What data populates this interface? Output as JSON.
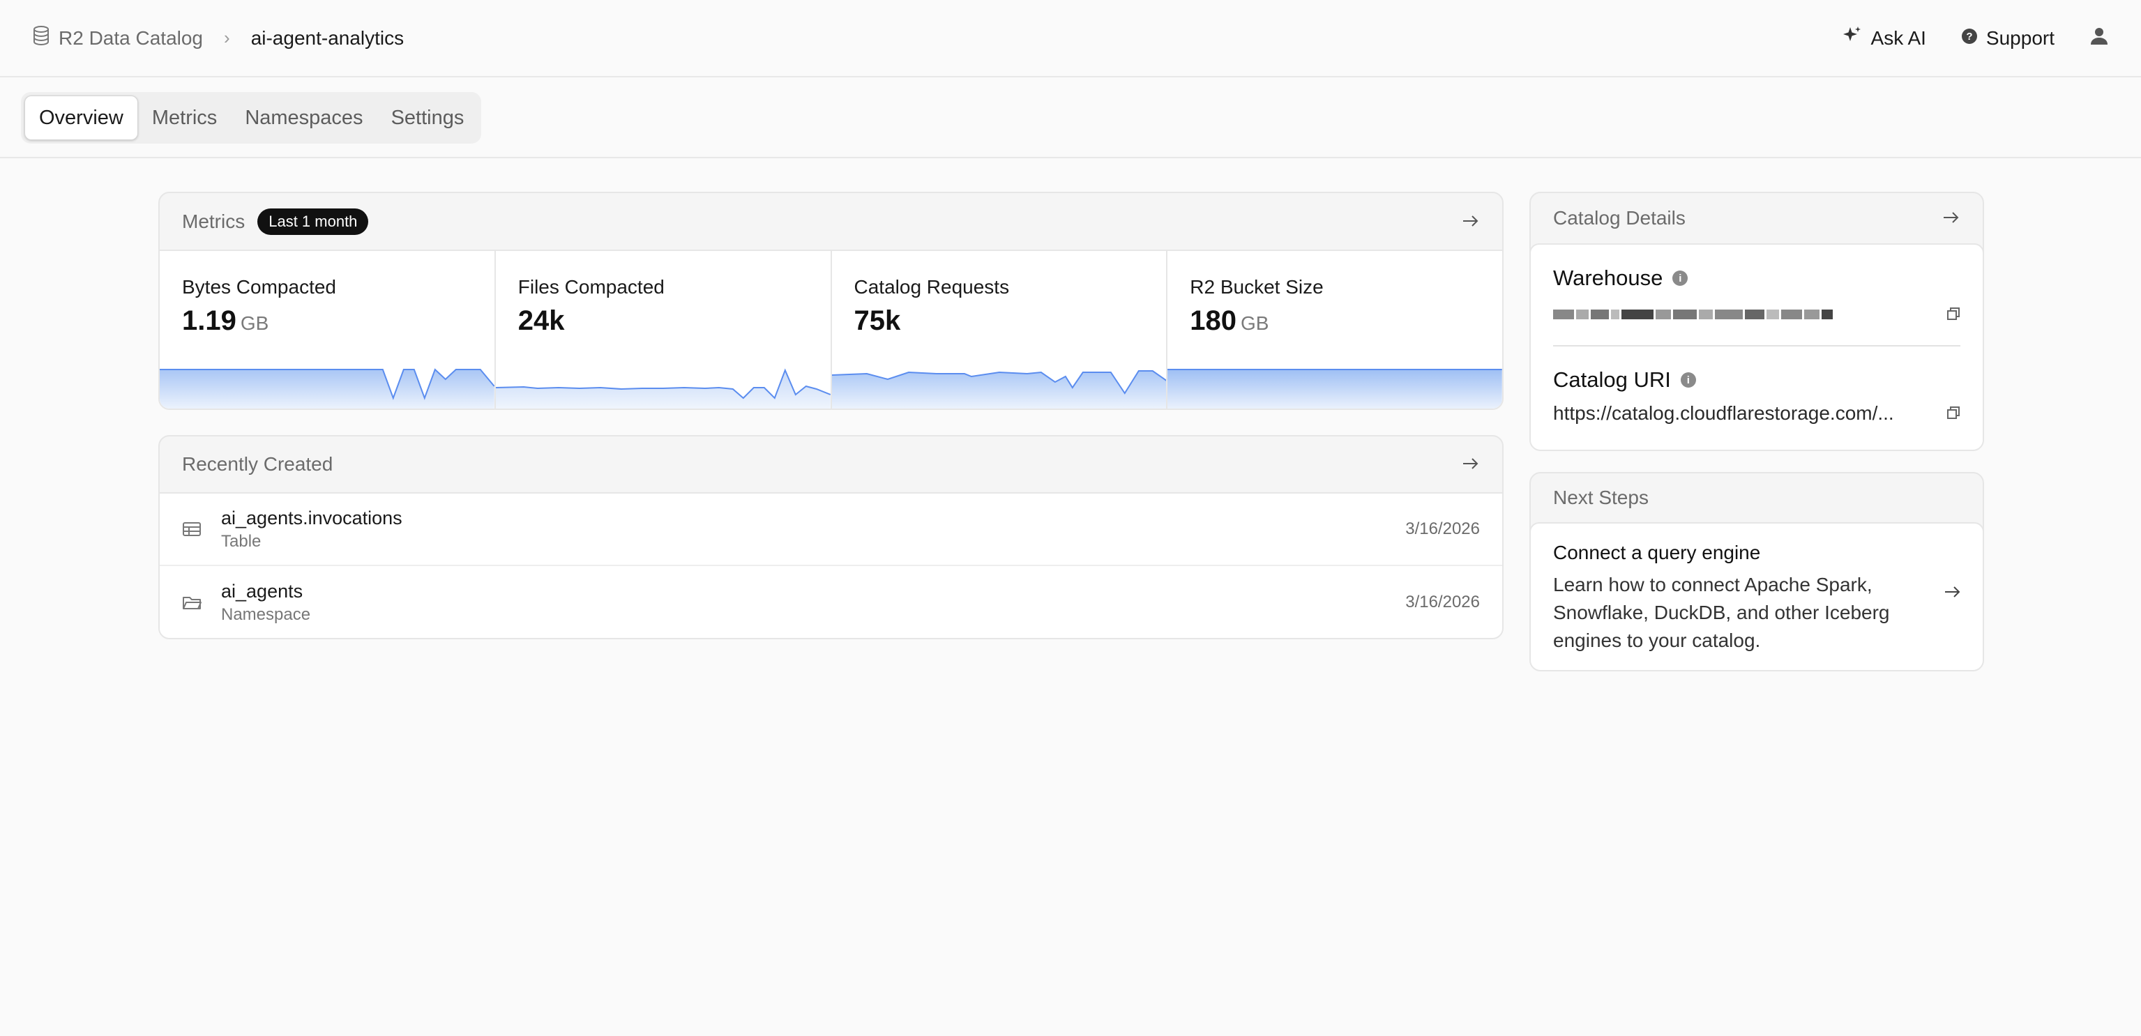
{
  "header": {
    "breadcrumb_root": "R2 Data Catalog",
    "breadcrumb_current": "ai-agent-analytics",
    "ask_ai": "Ask AI",
    "support": "Support"
  },
  "tabs": [
    "Overview",
    "Metrics",
    "Namespaces",
    "Settings"
  ],
  "active_tab": "Overview",
  "metrics_card": {
    "title": "Metrics",
    "range_badge": "Last 1 month",
    "items": [
      {
        "label": "Bytes Compacted",
        "value": "1.19",
        "unit": "GB"
      },
      {
        "label": "Files Compacted",
        "value": "24k",
        "unit": ""
      },
      {
        "label": "Catalog Requests",
        "value": "75k",
        "unit": ""
      },
      {
        "label": "R2 Bucket Size",
        "value": "180",
        "unit": "GB"
      }
    ]
  },
  "recently_created": {
    "title": "Recently Created",
    "items": [
      {
        "name": "ai_agents.invocations",
        "kind": "Table",
        "date": "3/16/2026",
        "icon": "table-icon"
      },
      {
        "name": "ai_agents",
        "kind": "Namespace",
        "date": "3/16/2026",
        "icon": "folder-icon"
      }
    ]
  },
  "catalog_details": {
    "title": "Catalog Details",
    "warehouse_label": "Warehouse",
    "catalog_uri_label": "Catalog URI",
    "catalog_uri_value": "https://catalog.cloudflarestorage.com/..."
  },
  "next_steps": {
    "title": "Next Steps",
    "item_title": "Connect a query engine",
    "item_desc": "Learn how to connect Apache Spark, Snowflake, DuckDB, and other Iceberg engines to your catalog."
  },
  "colors": {
    "accent_line": "#5b8def",
    "accent_fill": "#cfe0fb"
  }
}
